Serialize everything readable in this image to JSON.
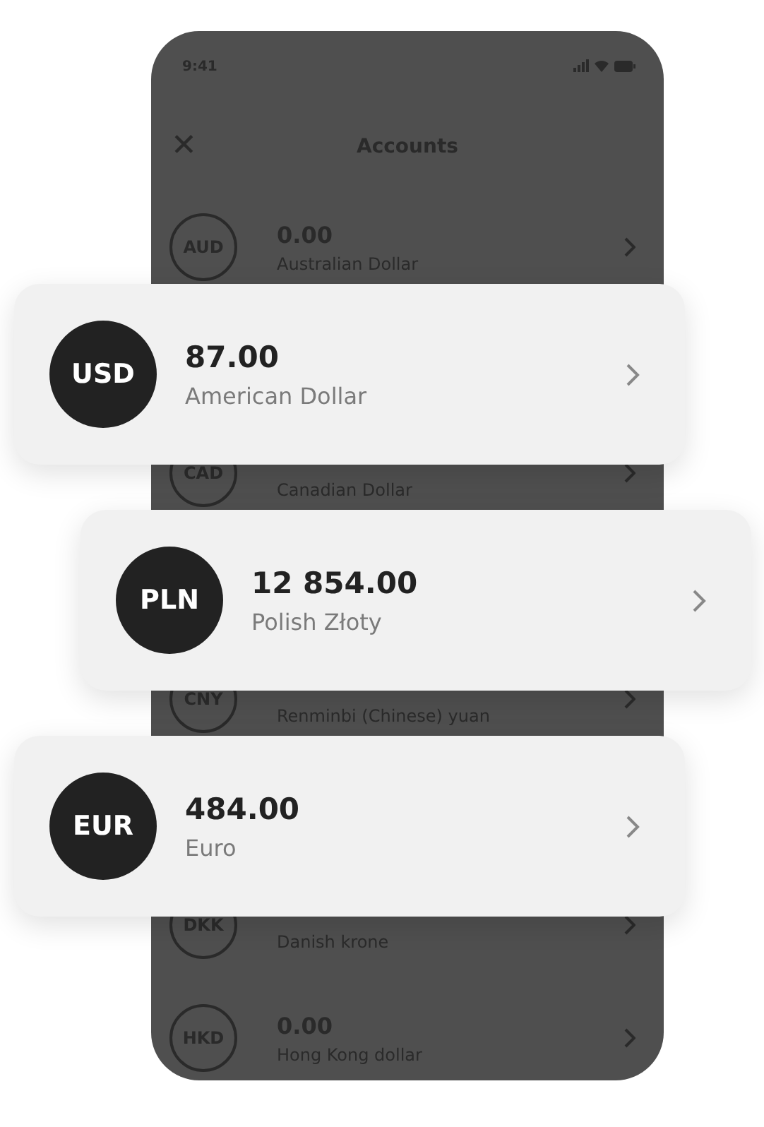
{
  "status_bar": {
    "time": "9:41"
  },
  "header": {
    "close": "✕",
    "title": "Accounts"
  },
  "list": [
    {
      "kind": "row",
      "code": "AUD",
      "amount": "0.00",
      "name": "Australian Dollar"
    },
    {
      "kind": "card",
      "code": "USD",
      "amount": "87.00",
      "name": "American Dollar"
    },
    {
      "kind": "row",
      "code": "CAD",
      "name": "Canadian Dollar"
    },
    {
      "kind": "card_inset",
      "code": "PLN",
      "amount": "12 854.00",
      "name": "Polish Złoty"
    },
    {
      "kind": "row",
      "code": "CNY",
      "name": "Renminbi (Chinese) yuan"
    },
    {
      "kind": "card",
      "code": "EUR",
      "amount": "484.00",
      "name": "Euro"
    },
    {
      "kind": "row",
      "code": "DKK",
      "name": "Danish krone"
    },
    {
      "kind": "row",
      "code": "HKD",
      "amount": "0.00",
      "name": "Hong Kong dollar"
    }
  ]
}
